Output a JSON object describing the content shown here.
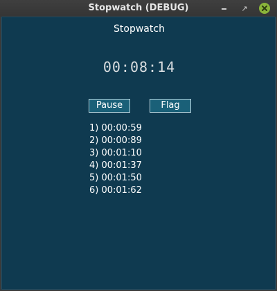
{
  "window": {
    "title": "Stopwatch (DEBUG)"
  },
  "app": {
    "title": "Stopwatch",
    "elapsed": "00:08:14",
    "pause_label": "Pause",
    "flag_label": "Flag",
    "laps": [
      "1) 00:00:59",
      "2) 00:00:89",
      "3) 00:01:10",
      "4) 00:01:37",
      "5) 00:01:50",
      "6) 00:01:62"
    ]
  },
  "colors": {
    "background": "#0f3a50",
    "button": "#1a6078",
    "close_button": "#8ab43a"
  },
  "icons": {
    "minimize": "minimize-icon",
    "maximize": "maximize-icon",
    "close": "close-icon"
  }
}
